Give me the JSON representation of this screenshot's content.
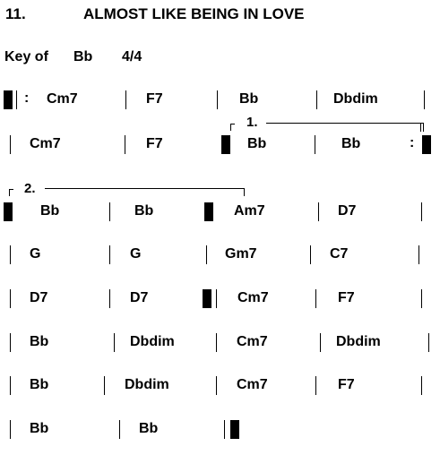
{
  "song": {
    "number": "11.",
    "title": "ALMOST LIKE BEING IN LOVE",
    "key_label": "Key of",
    "key": "Bb",
    "time_signature": "4/4"
  },
  "rows": [
    [
      "Cm7",
      "F7",
      "Bb",
      "Dbdim"
    ],
    [
      "Cm7",
      "F7",
      "Bb",
      "Bb"
    ],
    [
      "Bb",
      "Bb",
      "Am7",
      "D7"
    ],
    [
      "G",
      "G",
      "Gm7",
      "C7"
    ],
    [
      "D7",
      "D7",
      "Cm7",
      "F7"
    ],
    [
      "Bb",
      "Dbdim",
      "Cm7",
      "Dbdim"
    ],
    [
      "Bb",
      "Dbdim",
      "Cm7",
      "F7"
    ],
    [
      "Bb",
      "Bb"
    ]
  ],
  "endings": {
    "first": "1.",
    "second": "2."
  },
  "repeat_sign": ":"
}
